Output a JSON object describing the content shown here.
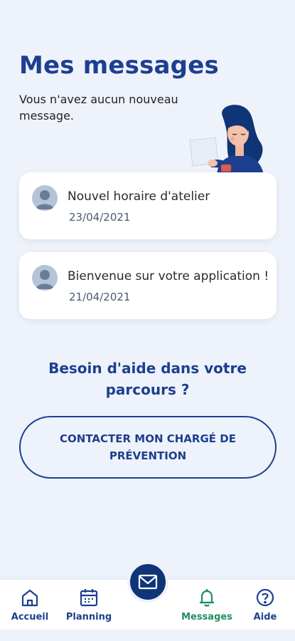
{
  "header": {
    "title": "Mes messages",
    "subtitle": "Vous n'avez aucun nouveau message."
  },
  "messages": [
    {
      "title": "Nouvel  horaire d'atelier",
      "date": "23/04/2021"
    },
    {
      "title": "Bienvenue sur votre application !",
      "date": "21/04/2021"
    }
  ],
  "help": {
    "heading": "Besoin d'aide dans votre parcours ?",
    "contact_button": "CONTACTER MON CHARGÉ DE PRÉVENTION"
  },
  "nav": {
    "items": [
      {
        "label": "Accueil",
        "icon": "home-icon"
      },
      {
        "label": "Planning",
        "icon": "calendar-icon"
      },
      {
        "label": "Messages",
        "icon": "bell-icon",
        "active": true
      },
      {
        "label": "Aide",
        "icon": "help-icon"
      }
    ],
    "fab_icon": "mail-icon"
  },
  "colors": {
    "background": "#eef3fb",
    "primary": "#1d3f8f",
    "active": "#1f8f5f",
    "fab": "#0f3577"
  }
}
